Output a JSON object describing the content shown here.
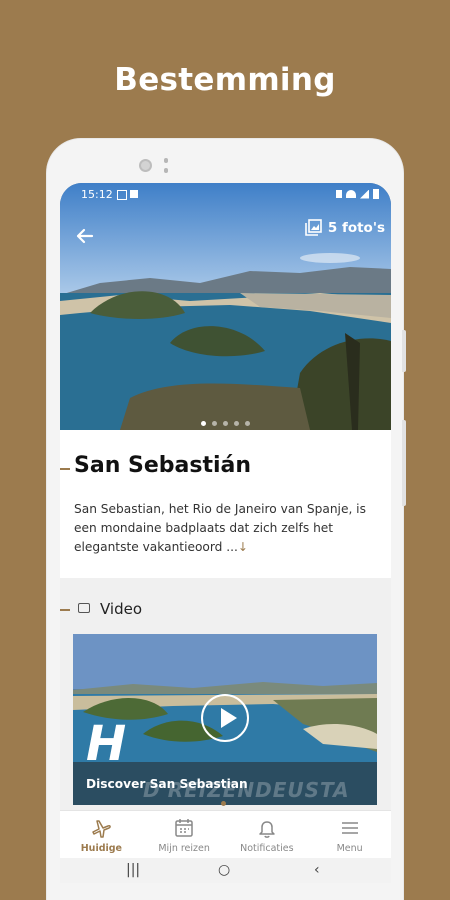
{
  "screen_title": "Bestemming",
  "status_bar": {
    "time": "15:12"
  },
  "hero": {
    "photos_label": "5 foto's",
    "page_count": 5,
    "active_page": 0
  },
  "destination": {
    "name": "San Sebastián",
    "description": "San Sebastian, het Rio de Janeiro van Spanje, is een mondaine badplaats dat zich zelfs het elegantste vakantieoord ...",
    "more_icon": "↓"
  },
  "video_section": {
    "heading": "Video",
    "caption": "Discover San Sebastian",
    "watermark": "D'REIZENDEUSTA",
    "logo": "H"
  },
  "bottom_nav": {
    "items": [
      {
        "label": "Huidige",
        "icon": "plane-icon",
        "active": true
      },
      {
        "label": "Mijn reizen",
        "icon": "calendar-icon",
        "active": false
      },
      {
        "label": "Notificaties",
        "icon": "bell-icon",
        "active": false
      },
      {
        "label": "Menu",
        "icon": "menu-icon",
        "active": false
      }
    ]
  },
  "system_nav": {
    "recents": "|||",
    "home": "○",
    "back": "‹"
  },
  "colors": {
    "accent": "#9c7b4e",
    "background": "#9c7b4e",
    "text": "#111111"
  }
}
